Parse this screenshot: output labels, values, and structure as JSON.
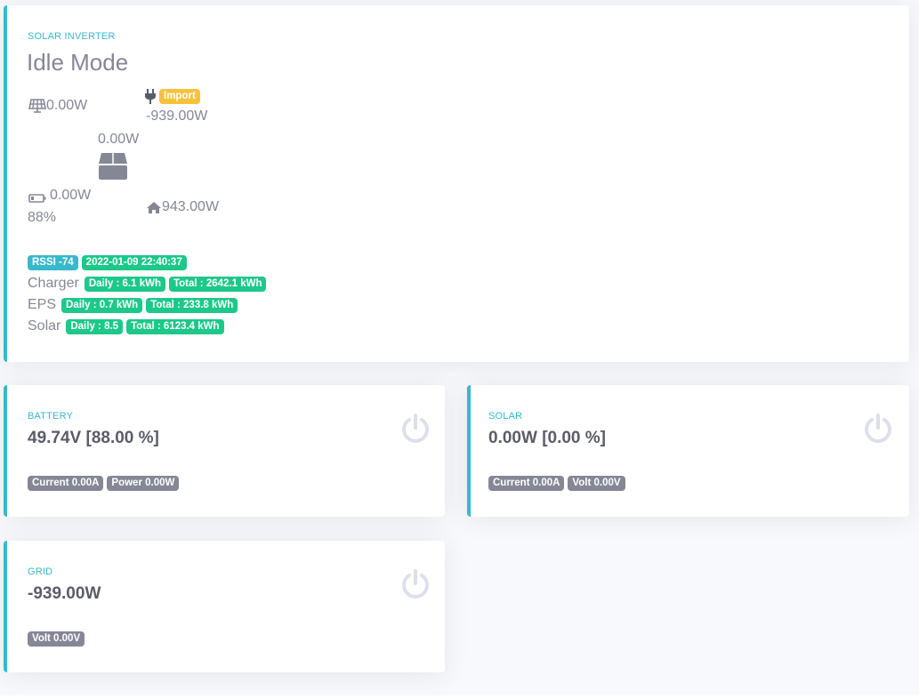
{
  "inverter": {
    "label": "SOLAR INVERTER",
    "mode": "Idle Mode",
    "solar_power": "0.00W",
    "grid_badge": "Import",
    "grid_power": "-939.00W",
    "inverter_power": "0.00W",
    "battery_power": "0.00W",
    "battery_percent": "88%",
    "home_power": "943.00W",
    "rssi": "RSSI -74",
    "timestamp": "2022-01-09 22:40:37",
    "rows": [
      {
        "label": "Charger",
        "daily": "Daily : 6.1 kWh",
        "total": "Total : 2642.1 kWh"
      },
      {
        "label": "EPS",
        "daily": "Daily : 0.7 kWh",
        "total": "Total : 233.8 kWh"
      },
      {
        "label": "Solar",
        "daily": "Daily : 8.5",
        "total": "Total : 6123.4 kWh"
      }
    ]
  },
  "battery": {
    "label": "BATTERY",
    "value": "49.74V [88.00 %]",
    "badges": [
      "Current 0.00A",
      "Power 0.00W"
    ]
  },
  "solar": {
    "label": "SOLAR",
    "value": "0.00W [0.00 %]",
    "badges": [
      "Current 0.00A",
      "Volt 0.00V"
    ]
  },
  "grid": {
    "label": "GRID",
    "value": "-939.00W",
    "badges": [
      "Volt 0.00V"
    ]
  },
  "colors": {
    "accent": "#36b9cc",
    "success": "#1cc88a",
    "warning": "#f6c23e",
    "secondary": "#858796",
    "power_icon": "#dddfeb"
  }
}
